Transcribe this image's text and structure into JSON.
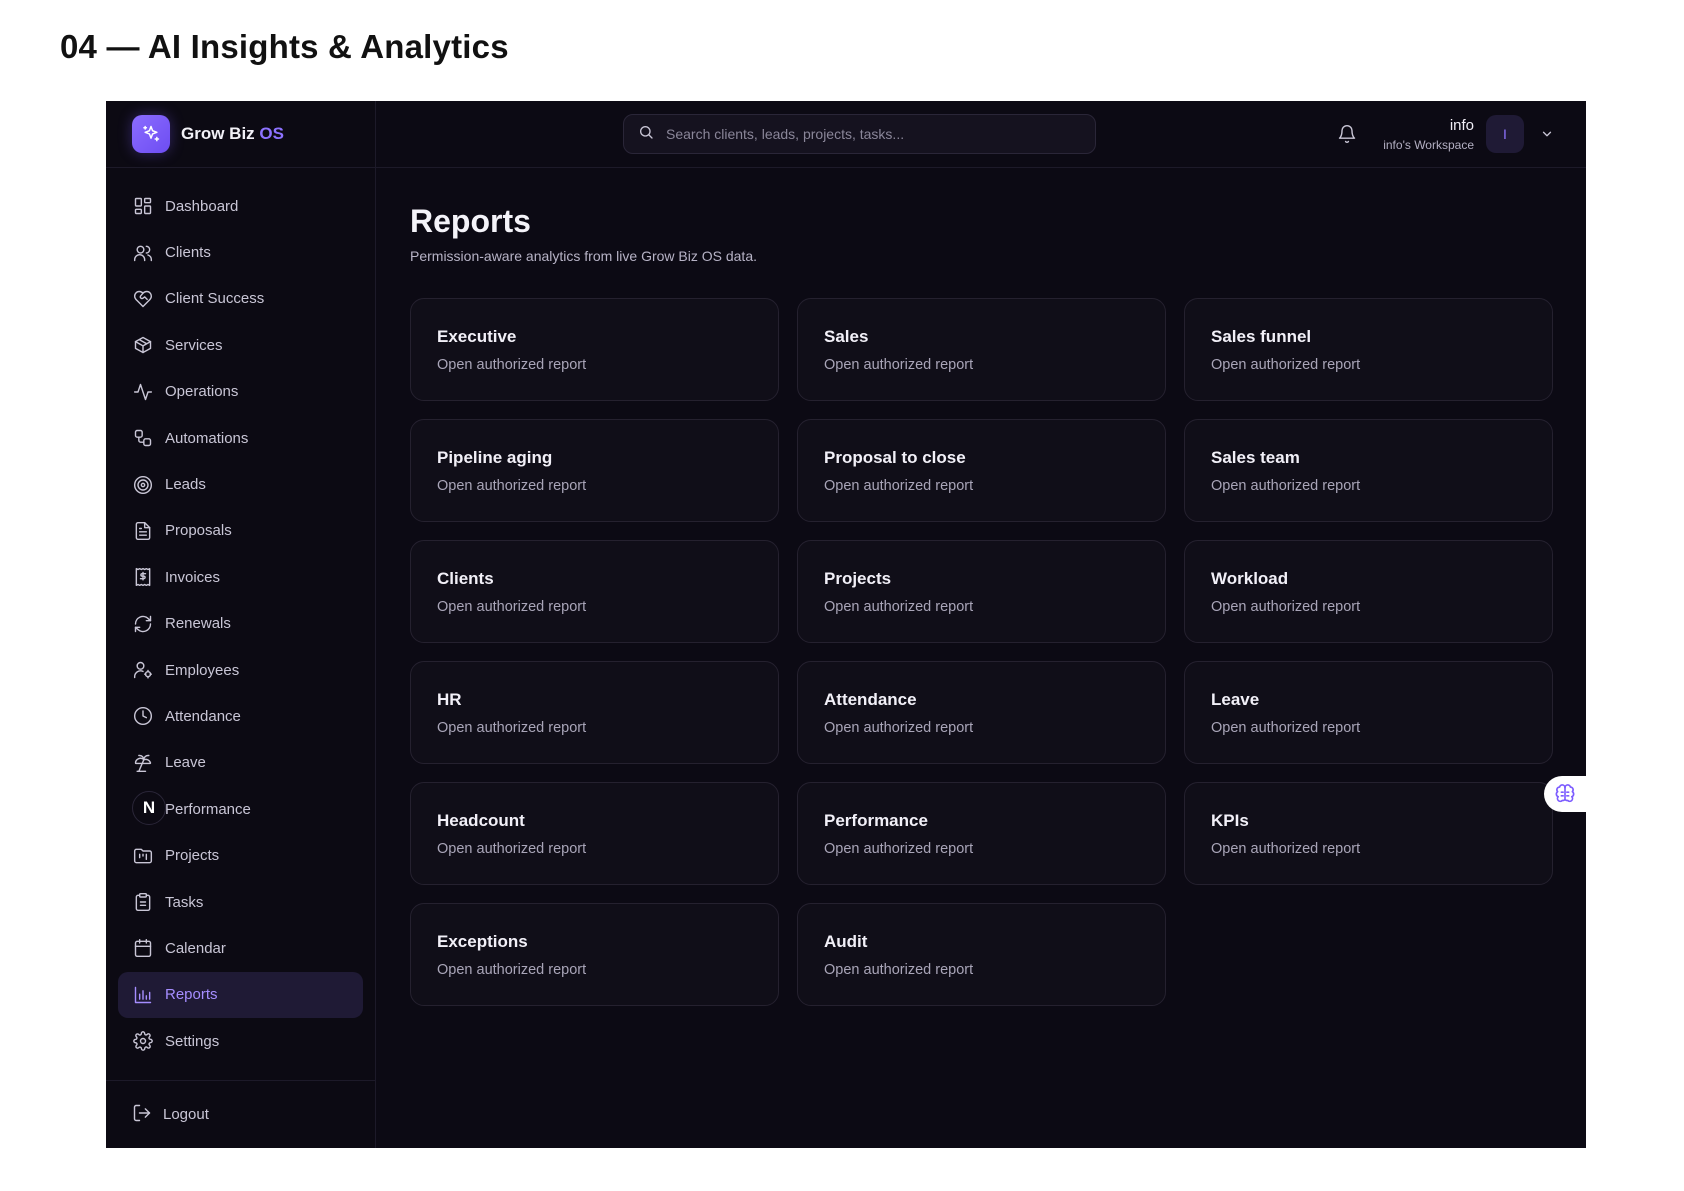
{
  "doc": {
    "heading": "04 — AI Insights & Analytics"
  },
  "brand": {
    "name": "Grow Biz",
    "accent": "OS"
  },
  "sidebar": {
    "items": [
      {
        "label": "Dashboard",
        "icon": "dashboard-icon"
      },
      {
        "label": "Clients",
        "icon": "users-icon"
      },
      {
        "label": "Client Success",
        "icon": "heart-handshake-icon"
      },
      {
        "label": "Services",
        "icon": "package-icon"
      },
      {
        "label": "Operations",
        "icon": "activity-icon"
      },
      {
        "label": "Automations",
        "icon": "workflow-icon"
      },
      {
        "label": "Leads",
        "icon": "target-icon"
      },
      {
        "label": "Proposals",
        "icon": "file-text-icon"
      },
      {
        "label": "Invoices",
        "icon": "receipt-icon"
      },
      {
        "label": "Renewals",
        "icon": "refresh-icon"
      },
      {
        "label": "Employees",
        "icon": "user-cog-icon"
      },
      {
        "label": "Attendance",
        "icon": "clock-icon"
      },
      {
        "label": "Leave",
        "icon": "palm-tree-icon"
      },
      {
        "label": "Performance",
        "icon": "n-badge-icon",
        "badge": "N"
      },
      {
        "label": "Projects",
        "icon": "folder-kanban-icon"
      },
      {
        "label": "Tasks",
        "icon": "clipboard-icon"
      },
      {
        "label": "Calendar",
        "icon": "calendar-icon"
      },
      {
        "label": "Reports",
        "icon": "bar-chart-icon",
        "active": true
      },
      {
        "label": "Settings",
        "icon": "gear-icon"
      }
    ],
    "logout": "Logout"
  },
  "topbar": {
    "search_placeholder": "Search clients, leads, projects, tasks...",
    "user_name": "info",
    "workspace": "info's Workspace",
    "avatar_initial": "I"
  },
  "page": {
    "title": "Reports",
    "subtitle": "Permission-aware analytics from live Grow Biz OS data."
  },
  "reports": [
    {
      "title": "Executive",
      "sub": "Open authorized report"
    },
    {
      "title": "Sales",
      "sub": "Open authorized report"
    },
    {
      "title": "Sales funnel",
      "sub": "Open authorized report"
    },
    {
      "title": "Pipeline aging",
      "sub": "Open authorized report"
    },
    {
      "title": "Proposal to close",
      "sub": "Open authorized report"
    },
    {
      "title": "Sales team",
      "sub": "Open authorized report"
    },
    {
      "title": "Clients",
      "sub": "Open authorized report"
    },
    {
      "title": "Projects",
      "sub": "Open authorized report"
    },
    {
      "title": "Workload",
      "sub": "Open authorized report"
    },
    {
      "title": "HR",
      "sub": "Open authorized report"
    },
    {
      "title": "Attendance",
      "sub": "Open authorized report"
    },
    {
      "title": "Leave",
      "sub": "Open authorized report"
    },
    {
      "title": "Headcount",
      "sub": "Open authorized report"
    },
    {
      "title": "Performance",
      "sub": "Open authorized report"
    },
    {
      "title": "KPIs",
      "sub": "Open authorized report"
    },
    {
      "title": "Exceptions",
      "sub": "Open authorized report"
    },
    {
      "title": "Audit",
      "sub": "Open authorized report"
    }
  ],
  "colors": {
    "background": "#0c0a14",
    "accent": "#8d72ff",
    "active_bg": "#1f1a35"
  }
}
